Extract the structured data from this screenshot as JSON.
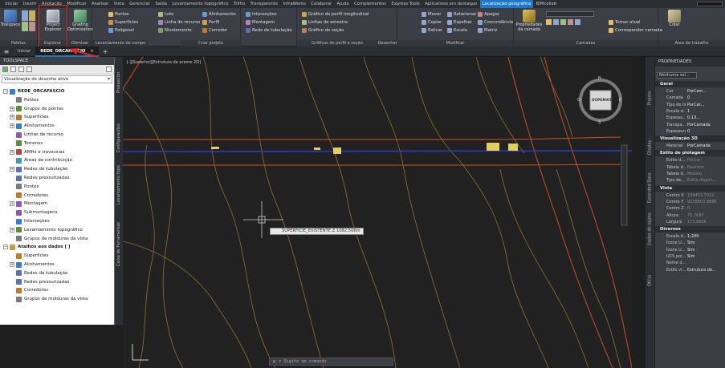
{
  "ribbon_tabs": [
    "Iniciar",
    "Inserir",
    "Anotação",
    "Modificar",
    "Analisar",
    "Vista",
    "Gerenciar",
    "Saída",
    "Levantamento topográfico",
    "Trilho",
    "Transparente",
    "InfraWorks",
    "Colaborar",
    "Ajuda",
    "Complementos",
    "Express Tools",
    "Aplicativos em destaque",
    "Localização geográfica",
    "BIMcollab"
  ],
  "ribbon_active_tab": "Localização geográfica",
  "ribbon": {
    "toolspace": "Toolspace",
    "project_explorer": "Project Explorer",
    "grading_optimization": "Grading Optimization",
    "palettes": "Paletas",
    "explorar": "Explorar",
    "otimizar": "Otimizar",
    "group1_items": [
      "Pontos",
      "Superfícies",
      "Poligonal"
    ],
    "group1_title": "Levantamento de campo",
    "group2_items": [
      "Lote",
      "Linha de recurso",
      "Nivelamento"
    ],
    "group3_items": [
      "Alinhamento",
      "Perfil",
      "Corredor"
    ],
    "group3_title": "Criar projeto",
    "group4_items": [
      "Interseções",
      "Montagem",
      "Rede de tubulação"
    ],
    "group5_items": [
      "Gráfico do perfil longitudinal",
      "Linhas de amostra",
      "Gráfico de seção"
    ],
    "group5_title": "Gráficos de perfil e seção",
    "desenhar": "Desenhar",
    "group6_items": [
      "Mover",
      "Copiar",
      "Esticar"
    ],
    "group7_items": [
      "Rotacionar",
      "Espelhar",
      "Escala"
    ],
    "group8_items": [
      "Apagar",
      "Concordância",
      "Matriz"
    ],
    "modificar": "Modificar",
    "propriedades_camada": "Propriedades da camada",
    "tornar_atual": "Tornar atual",
    "corresponder_camada": "Corresponder camada",
    "camadas": "Camadas",
    "colar": "Colar",
    "area_transf": "Área de trabalho"
  },
  "doc_tabs": {
    "home": "Iniciar",
    "active": "REDE_ORCAFASCIO",
    "close": "×",
    "add": "+"
  },
  "toolspace": {
    "title": "TOOLSPACE",
    "view_select": "Visualização de desenho ativo",
    "tree": [
      {
        "label": "REDE_ORCAFASCIO",
        "level": 0,
        "exp": "−",
        "color": "#3a7bd5"
      },
      {
        "label": "Pontos",
        "level": 1,
        "exp": "",
        "color": "#7a7a7a"
      },
      {
        "label": "Grupos de pontos",
        "level": 1,
        "exp": "+",
        "color": "#5b8f3a"
      },
      {
        "label": "Superfícies",
        "level": 1,
        "exp": "+",
        "color": "#c07a2a"
      },
      {
        "label": "Alinhamentos",
        "level": 1,
        "exp": "+",
        "color": "#3a7bd5"
      },
      {
        "label": "Linhas de recurso",
        "level": 1,
        "exp": "",
        "color": "#8a5ab0"
      },
      {
        "label": "Terrenos",
        "level": 1,
        "exp": "",
        "color": "#5b8f3a"
      },
      {
        "label": "AMHs e travessias",
        "level": 1,
        "exp": "+",
        "color": "#c04040"
      },
      {
        "label": "Áreas de contribuição",
        "level": 1,
        "exp": "",
        "color": "#3aa0a0"
      },
      {
        "label": "Redes de tubulação",
        "level": 1,
        "exp": "+",
        "color": "#5a70b0"
      },
      {
        "label": "Redes pressurizadas",
        "level": 1,
        "exp": "",
        "color": "#5a70b0"
      },
      {
        "label": "Pontes",
        "level": 1,
        "exp": "",
        "color": "#7a7a7a"
      },
      {
        "label": "Corredores",
        "level": 1,
        "exp": "",
        "color": "#c07a2a"
      },
      {
        "label": "Montagem",
        "level": 1,
        "exp": "+",
        "color": "#8a5ab0"
      },
      {
        "label": "Submontagens",
        "level": 1,
        "exp": "",
        "color": "#8a5ab0"
      },
      {
        "label": "Interseções",
        "level": 1,
        "exp": "",
        "color": "#3a7bd5"
      },
      {
        "label": "Levantamento topográfico",
        "level": 1,
        "exp": "+",
        "color": "#5b8f3a"
      },
      {
        "label": "Grupos de molduras da vista",
        "level": 1,
        "exp": "",
        "color": "#7a7a7a"
      },
      {
        "label": "Atalhos aos dados [ ]",
        "level": 0,
        "exp": "−",
        "color": "#c0a040"
      },
      {
        "label": "Superfícies",
        "level": 1,
        "exp": "",
        "color": "#c07a2a"
      },
      {
        "label": "Alinhamentos",
        "level": 1,
        "exp": "+",
        "color": "#3a7bd5"
      },
      {
        "label": "Redes de tubulação",
        "level": 1,
        "exp": "",
        "color": "#5a70b0"
      },
      {
        "label": "Redes pressurizadas",
        "level": 1,
        "exp": "",
        "color": "#5a70b0"
      },
      {
        "label": "Corredores",
        "level": 1,
        "exp": "",
        "color": "#c07a2a"
      },
      {
        "label": "Grupos de molduras da vista",
        "level": 1,
        "exp": "",
        "color": "#7a7a7a"
      }
    ]
  },
  "left_vtabs": [
    "Prospector",
    "Configurações",
    "Caixa de Ferramentas",
    "Levantamento topo"
  ],
  "viewport": {
    "label": "[-][Superior][Estrutura de arame 2D]",
    "viewcube_top": "SUPERIOR",
    "viewcube_n": "N",
    "viewcube_s": "S",
    "viewcube_e": "E",
    "viewcube_w": "O",
    "surface_tooltip": "SUPERFICIE_EXISTENTE    Z    1082.506m"
  },
  "command_line": {
    "placeholder": "Digite um comando"
  },
  "properties": {
    "title": "PROPRIEDADES",
    "selection": "Nenhuma sel...",
    "sections": [
      {
        "title": "Geral",
        "rows": [
          [
            "Cor",
            "PorCam..."
          ],
          [
            "Camada",
            "0"
          ],
          [
            "Tipo de linha",
            "PorCat..."
          ],
          [
            "Escala d...",
            "1"
          ],
          [
            "Espessu...",
            "0.13..."
          ],
          [
            "Transpa...",
            "PorCamada"
          ],
          [
            "Espessura",
            "0"
          ]
        ]
      },
      {
        "title": "Visualização 3D",
        "rows": [
          [
            "Material",
            "PorCamada"
          ]
        ]
      },
      {
        "title": "Estilo de plotagem",
        "rows": [
          [
            "Estilo d...",
            "PorCor"
          ],
          [
            "Tabela d...",
            "Nenhum"
          ],
          [
            "Tabela d...",
            "Modelo"
          ],
          [
            "Tipo de...",
            "Estilo dispon..."
          ]
        ]
      },
      {
        "title": "Vista",
        "rows": [
          [
            "Centro X",
            "199453.7032"
          ],
          [
            "Centro Y",
            "9239803.9888"
          ],
          [
            "Centro Z",
            "0"
          ],
          [
            "Altura",
            "75.7697"
          ],
          [
            "Largura",
            "171.8656"
          ]
        ]
      },
      {
        "title": "Diversos",
        "rows": [
          [
            "Escala d...",
            "1:200"
          ],
          [
            "Ícone U...",
            "Sim"
          ],
          [
            "Ícone U...",
            "Sim"
          ],
          [
            "UCS por...",
            "Sim"
          ],
          [
            "Nome d...",
            ""
          ],
          [
            "Estilo vi...",
            "Estrutura de..."
          ]
        ]
      }
    ]
  },
  "right_vtabs": [
    "Projeto",
    "Display",
    "Extended Data",
    "Dados de objeto",
    "Ofício"
  ],
  "colors": {
    "accent": "#1e78c8",
    "annotation": "#e02828",
    "alignment": "#2a3ac8",
    "contour": "#a08030",
    "surface_edge": "#c85028"
  }
}
